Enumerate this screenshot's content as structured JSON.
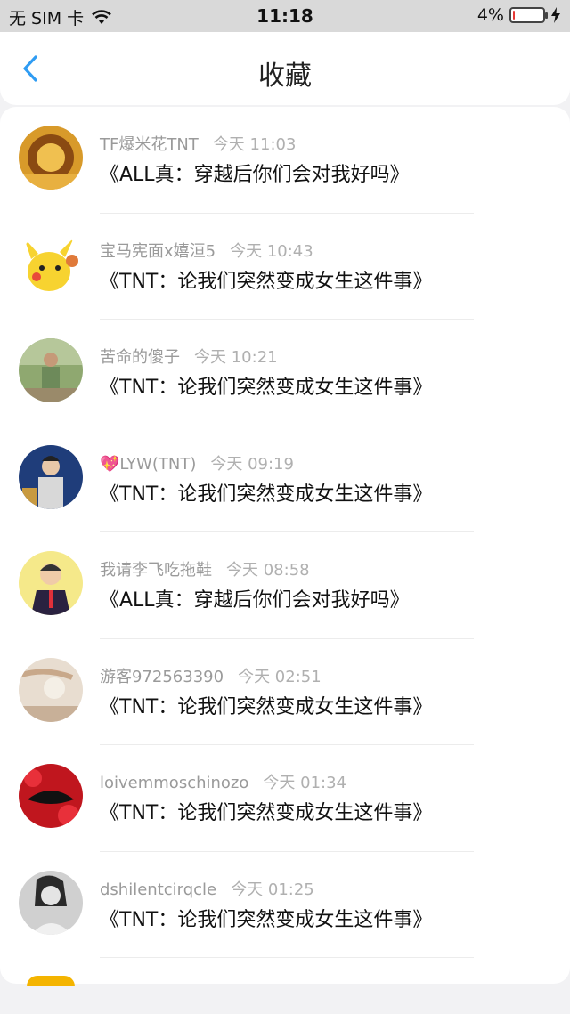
{
  "status": {
    "carrier": "无 SIM 卡",
    "time": "11:18",
    "battery_label": "4%",
    "battery_level": 0.04
  },
  "nav": {
    "title": "收藏",
    "back_icon": "chevron-left-icon",
    "accent": "#2f9cf3"
  },
  "items": [
    {
      "user": "TF爆米花TNT",
      "time": "今天 11:03",
      "title": "《ALL真：穿越后你们会对我好吗》"
    },
    {
      "user": "宝马宪面x嬉洹5",
      "time": "今天 10:43",
      "title": "《TNT：论我们突然变成女生这件事》"
    },
    {
      "user": "苦命的傻子",
      "time": "今天 10:21",
      "title": "《TNT：论我们突然变成女生这件事》"
    },
    {
      "user": "LYW(TNT)",
      "time": "今天 09:19",
      "title": "《TNT：论我们突然变成女生这件事》",
      "emoji": "💖"
    },
    {
      "user": "我请李飞吃拖鞋",
      "time": "今天 08:58",
      "title": "《ALL真：穿越后你们会对我好吗》"
    },
    {
      "user": "游客972563390",
      "time": "今天 02:51",
      "title": "《TNT：论我们突然变成女生这件事》"
    },
    {
      "user": "loivemmoschinozo",
      "time": "今天 01:34",
      "title": "《TNT：论我们突然变成女生这件事》"
    },
    {
      "user": "dshilentcirqcle",
      "time": "今天 01:25",
      "title": "《TNT：论我们突然变成女生这件事》"
    }
  ]
}
